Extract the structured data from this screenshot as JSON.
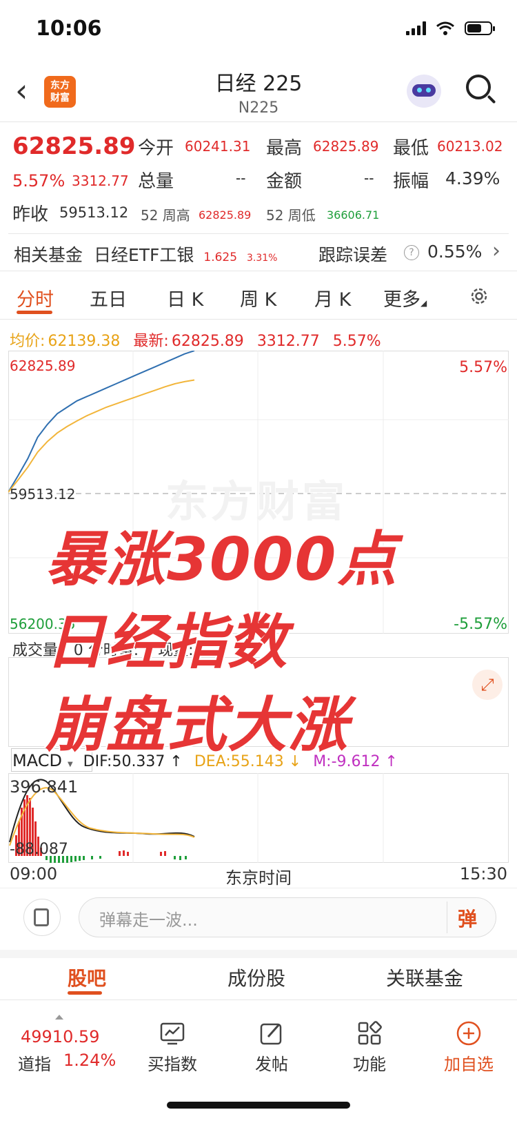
{
  "status": {
    "time": "10:06"
  },
  "header": {
    "logo_line1": "东方",
    "logo_line2": "财富",
    "title": "日经 225",
    "subtitle": "N225"
  },
  "quote": {
    "price": "62825.89",
    "change_pct": "5.57%",
    "change_val": "3312.77",
    "open_label": "今开",
    "open_value": "60241.31",
    "high_label": "最高",
    "high_value": "62825.89",
    "low_label": "最低",
    "low_value": "60213.02",
    "volume_label": "总量",
    "volume_value": "--",
    "amount_label": "金额",
    "amount_value": "--",
    "amplitude_label": "振幅",
    "amplitude_value": "4.39%",
    "prev_close_label": "昨收",
    "prev_close_value": "59513.12",
    "high52_label": "52 周高",
    "high52_value": "62825.89",
    "low52_label": "52 周低",
    "low52_value": "36606.71"
  },
  "fund": {
    "label": "相关基金",
    "name": "日经ETF工银",
    "price": "1.625",
    "pct": "3.31%",
    "track_label": "跟踪误差",
    "track_value": "0.55%"
  },
  "tabs": [
    "分时",
    "五日",
    "日 K",
    "周 K",
    "月 K",
    "更多"
  ],
  "avg_row": {
    "avg_label": "均价:",
    "avg_value": "62139.38",
    "latest_label": "最新:",
    "latest_value": "62825.89",
    "latest_change": "3312.77",
    "latest_pct": "5.57%"
  },
  "chart_labels": {
    "top_left": "62825.89",
    "top_right": "5.57%",
    "mid_left": "59513.12",
    "bottom_left": "56200.35",
    "bottom_right": "-5.57%",
    "watermark": "东方财富"
  },
  "overlay": {
    "line1": "暴涨3000点",
    "line2": "日经指数",
    "line3": "崩盘式大涨"
  },
  "volume_row": {
    "selector": "成交量",
    "text": "0 分时量: 0 现量:"
  },
  "macd_row": {
    "selector": "MACD",
    "dif": "DIF:50.337 ↑",
    "dea": "DEA:55.143 ↓",
    "m": "M:-9.612 ↑",
    "max": "396.841",
    "min": "-88.087"
  },
  "time_axis": {
    "start": "09:00",
    "zone": "东京时间",
    "end": "15:30"
  },
  "comment": {
    "placeholder": "弹幕走一波...",
    "button": "弹"
  },
  "sub_tabs": [
    "股吧",
    "成份股",
    "关联基金"
  ],
  "bottom_nav": {
    "index_price": "49910.59",
    "index_name": "道指",
    "index_pct": "1.24%",
    "items": [
      "买指数",
      "发帖",
      "功能",
      "加自选"
    ]
  },
  "colors": {
    "up": "#e02a2a",
    "down": "#1e9e3a",
    "avg_line": "#f2b53a",
    "price_line": "#2f6fb0",
    "accent": "#e0501f"
  },
  "chart_data": {
    "type": "line",
    "series": [
      {
        "name": "最新",
        "values": [
          59513,
          59900,
          60300,
          60800,
          61100,
          61350,
          61500,
          61650,
          61750,
          61850,
          61950,
          62050,
          62150,
          62250,
          62350,
          62450,
          62550,
          62650,
          62750,
          62825
        ]
      },
      {
        "name": "均价",
        "values": [
          59513,
          59800,
          60100,
          60450,
          60700,
          60900,
          61050,
          61180,
          61300,
          61400,
          61500,
          61580,
          61660,
          61740,
          61820,
          61900,
          61980,
          62050,
          62100,
          62139
        ]
      }
    ],
    "ylim": [
      56200.35,
      62825.89
    ]
  }
}
